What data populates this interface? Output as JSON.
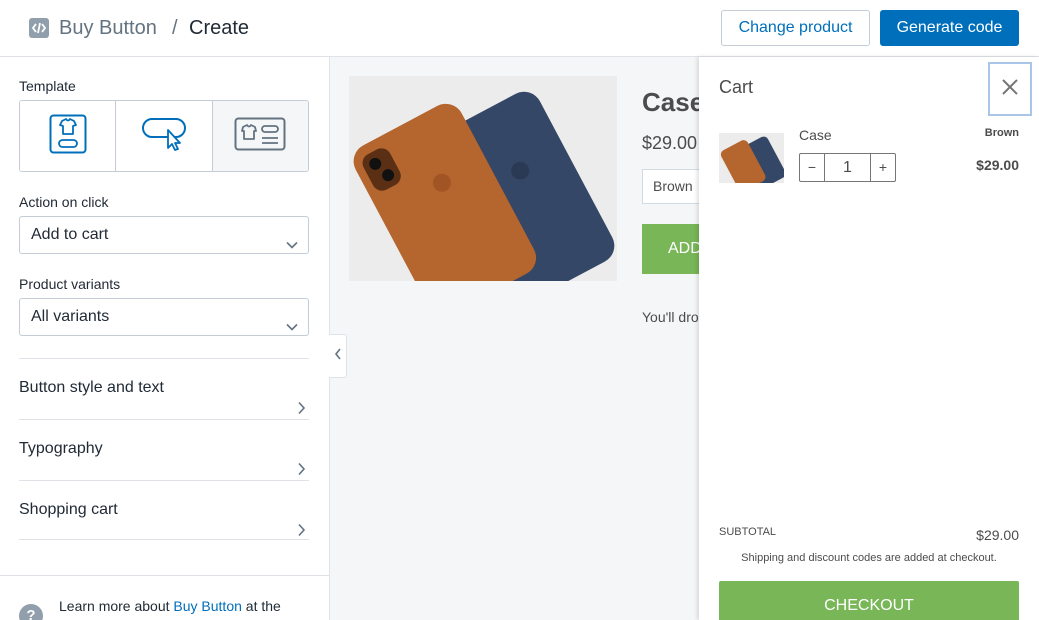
{
  "header": {
    "breadcrumb_parent": "Buy Button",
    "breadcrumb_separator": "/",
    "breadcrumb_current": "Create",
    "change_product_label": "Change product",
    "generate_code_label": "Generate code"
  },
  "sidebar": {
    "template_label": "Template",
    "templates": [
      {
        "icon": "product-card-icon"
      },
      {
        "icon": "button-cursor-icon"
      },
      {
        "icon": "product-detail-icon"
      }
    ],
    "action_label": "Action on click",
    "action_value": "Add to cart",
    "variants_label": "Product variants",
    "variants_value": "All variants",
    "sections": [
      {
        "label": "Button style and text"
      },
      {
        "label": "Typography"
      },
      {
        "label": "Shopping cart"
      }
    ],
    "help": {
      "prefix": "Learn more about ",
      "link": "Buy Button",
      "suffix": " at the"
    }
  },
  "preview": {
    "title": "Case",
    "price": "$29.00",
    "variant": "Brown",
    "add_button": "ADD",
    "description": "You'll dro protect it"
  },
  "cart": {
    "title": "Cart",
    "item": {
      "name": "Case",
      "variant": "Brown",
      "quantity": "1",
      "price": "$29.00",
      "decrement": "−",
      "increment": "+"
    },
    "subtotal_label": "SUBTOTAL",
    "subtotal_value": "$29.00",
    "shipping_note": "Shipping and discount codes are added at checkout.",
    "checkout_label": "CHECKOUT"
  },
  "colors": {
    "primary": "#006fbb",
    "cart_green": "#78b657",
    "case_brown": "#b5652e",
    "case_navy": "#344766"
  }
}
